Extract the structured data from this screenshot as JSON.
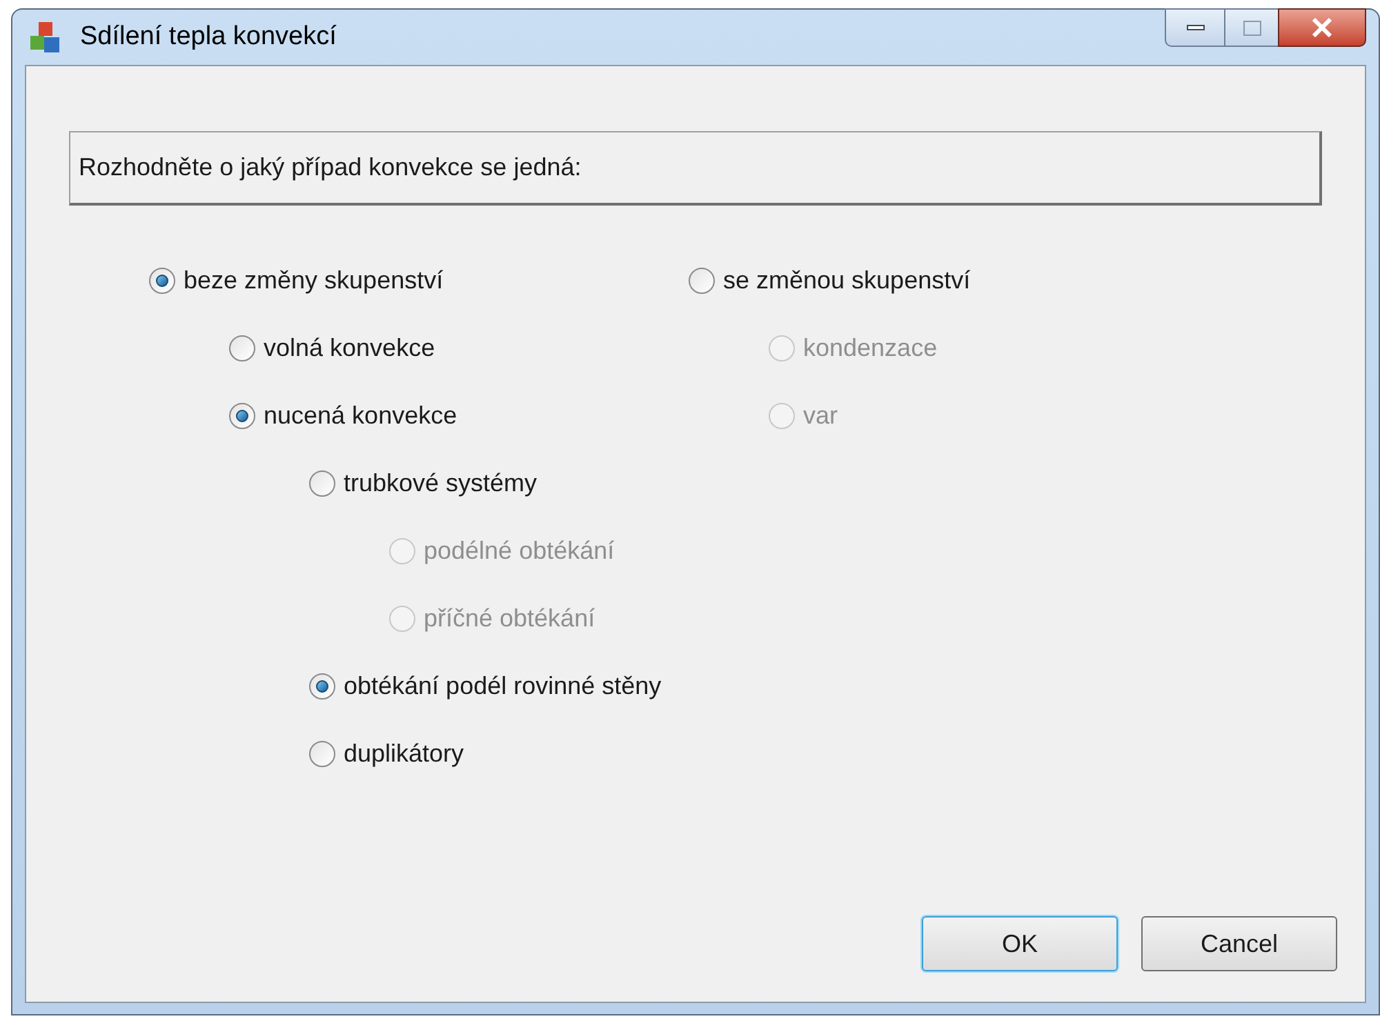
{
  "window": {
    "title": "Sdílení tepla konvekcí"
  },
  "prompt": "Rozhodněte o jaký případ konvekce se jedná:",
  "options_left": [
    {
      "label": "beze změny skupenství",
      "selected": true,
      "disabled": false,
      "children": [
        {
          "label": "volná konvekce",
          "selected": false,
          "disabled": false
        },
        {
          "label": "nucená konvekce",
          "selected": true,
          "disabled": false,
          "children": [
            {
              "label": "trubkové systémy",
              "selected": false,
              "disabled": false,
              "children": [
                {
                  "label": "podélné obtékání",
                  "selected": false,
                  "disabled": true
                },
                {
                  "label": "příčné obtékání",
                  "selected": false,
                  "disabled": true
                }
              ]
            },
            {
              "label": "obtékání podél rovinné stěny",
              "selected": true,
              "disabled": false
            },
            {
              "label": "duplikátory",
              "selected": false,
              "disabled": false
            }
          ]
        }
      ]
    }
  ],
  "options_right": [
    {
      "label": "se změnou skupenství",
      "selected": false,
      "disabled": false,
      "children": [
        {
          "label": "kondenzace",
          "selected": false,
          "disabled": true
        },
        {
          "label": "var",
          "selected": false,
          "disabled": true
        }
      ]
    }
  ],
  "buttons": [
    {
      "label": "OK",
      "default": true
    },
    {
      "label": "Cancel",
      "default": false
    }
  ]
}
